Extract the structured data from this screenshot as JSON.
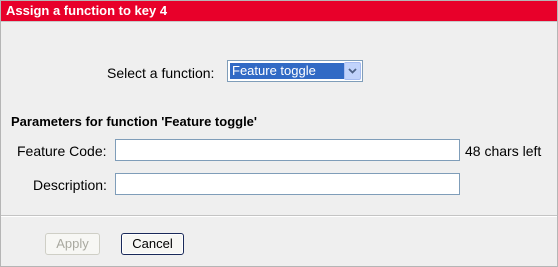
{
  "dialog": {
    "title": "Assign a function to key 4"
  },
  "function_select": {
    "label": "Select a function:",
    "selected": "Feature toggle"
  },
  "parameters": {
    "heading": "Parameters for function 'Feature toggle'",
    "feature_code": {
      "label": "Feature Code:",
      "value": "",
      "chars_left": "48 chars left"
    },
    "description": {
      "label": "Description:",
      "value": ""
    }
  },
  "buttons": {
    "apply": "Apply",
    "cancel": "Cancel"
  },
  "colors": {
    "title_bar": "#e8002a",
    "selection": "#316ac5",
    "panel_bg": "#efefef"
  },
  "icons": {
    "dropdown": "chevron-down-icon"
  }
}
